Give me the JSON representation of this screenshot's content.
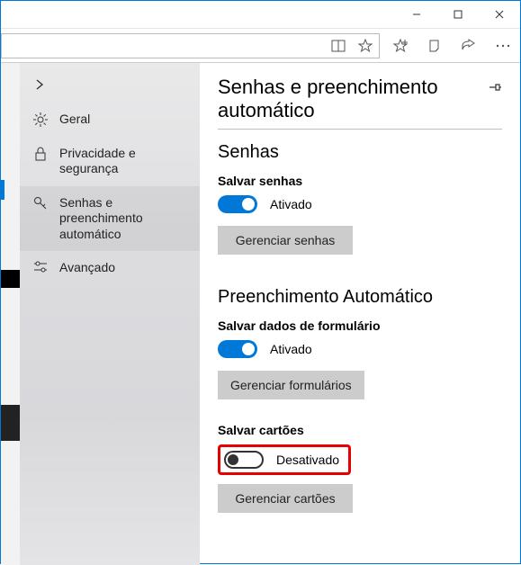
{
  "window": {
    "minimize": "–",
    "maximize": "▢",
    "close": "✕"
  },
  "sidebar": {
    "items": [
      {
        "label": "Geral"
      },
      {
        "label": "Privacidade e segurança"
      },
      {
        "label": "Senhas e preenchimento automático"
      },
      {
        "label": "Avançado"
      }
    ]
  },
  "content": {
    "title": "Senhas e preenchimento automático",
    "section_passwords": {
      "heading": "Senhas",
      "save_passwords_label": "Salvar senhas",
      "save_passwords_state": "Ativado",
      "manage_passwords_btn": "Gerenciar senhas"
    },
    "section_autofill": {
      "heading": "Preenchimento Automático",
      "save_form_label": "Salvar dados de formulário",
      "save_form_state": "Ativado",
      "manage_forms_btn": "Gerenciar formulários",
      "save_cards_label": "Salvar cartões",
      "save_cards_state": "Desativado",
      "manage_cards_btn": "Gerenciar cartões"
    }
  }
}
